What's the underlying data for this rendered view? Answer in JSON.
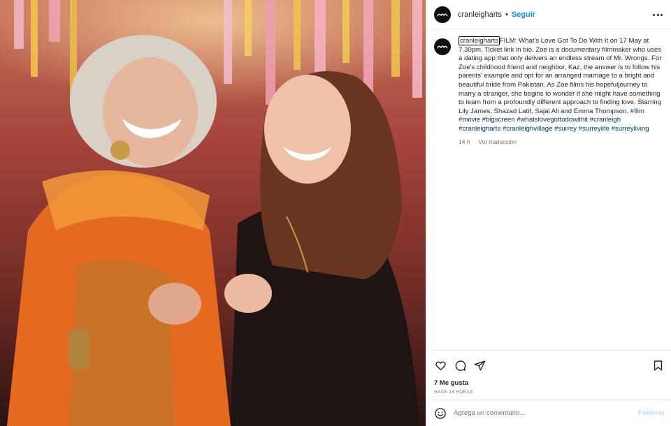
{
  "post": {
    "username": "cranleigharts",
    "separator": "•",
    "follow_label": "Seguir",
    "more_icon": "more-horizontal-icon",
    "image": {
      "description_icon": "photo-two-women-laughing"
    },
    "caption": {
      "username": "cranleigharts",
      "text": "FILM: What's Love Got To Do With It on 17 May at 7.30pm. Ticket link in bio. Zoe is a documentary filmmaker who uses a dating app that only delivers an endless stream of Mr. Wrongs. For Zoe's childhood friend and neighbor, Kaz, the answer is to follow his parents' example and opt for an arranged marriage to a bright and beautiful bride from Pakistan. As Zoe films his hopefuljourney to marry a stranger, she begins to wonder if she might have something to learn from a profoundly different approach to finding love. Starring Lily James, Shazad Latif, Sajal Ali and Emma Thompson. ",
      "hashtags": [
        "#film",
        "#movie",
        "#bigscreen",
        "#whatslovegottodowithit",
        "#cranleigh",
        "#cranleigharts",
        "#cranleighvillage",
        "#surrey",
        "#surreylife",
        "#surreyliving"
      ],
      "time": "14 h",
      "translate_label": "Ver traducción"
    },
    "likes": "7 Me gusta",
    "time_ago": "HACE 14 HORAS",
    "comment": {
      "placeholder": "Agrega un comentario...",
      "value": "",
      "publish_label": "Publicar"
    }
  },
  "colors": {
    "link_blue": "#0095f6",
    "hashtag_blue": "#00376b",
    "muted": "#737373",
    "publish_disabled": "#b2dffc"
  }
}
